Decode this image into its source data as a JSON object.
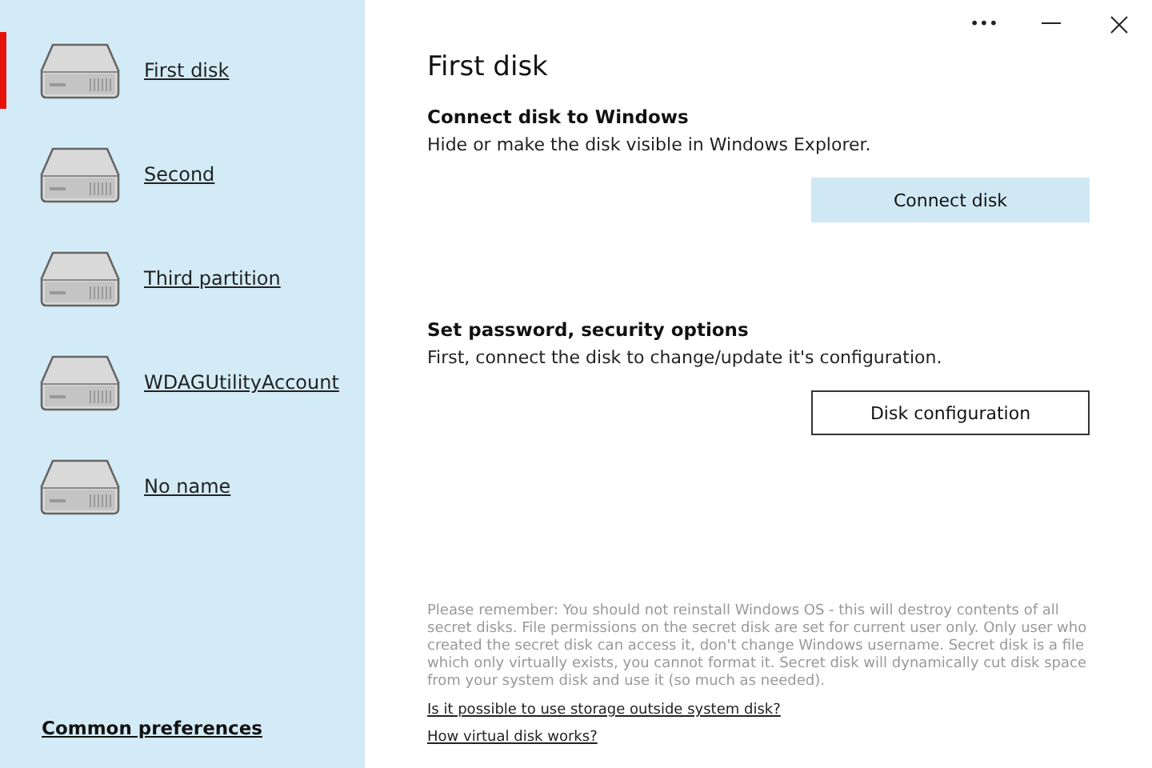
{
  "window_controls": [
    {
      "kind": "more",
      "label": "•••"
    },
    {
      "kind": "minimize"
    },
    {
      "kind": "close"
    }
  ],
  "sidebar": {
    "items": [
      {
        "label": "First disk",
        "selected": true
      },
      {
        "label": "Second",
        "selected": false
      },
      {
        "label": "Third partition",
        "selected": false
      },
      {
        "label": "WDAGUtilityAccount",
        "selected": false
      },
      {
        "label": "No name",
        "selected": false
      }
    ],
    "footer_link": "Common preferences"
  },
  "title": "First disk",
  "sections": [
    {
      "heading": "Connect disk to Windows",
      "description": "Hide or make the disk visible in Windows Explorer.",
      "button": "Connect disk",
      "kind": "primary"
    },
    {
      "heading": "Set password, security options",
      "description": "First, connect the disk to change/update it's configuration.",
      "button": "Disk configuration",
      "kind": "outline"
    }
  ],
  "notice": "Please remember: You should not reinstall Windows OS - this will destroy contents of all secret disks. File permissions on the secret disk are set for current user only. Only user who created the secret disk can access it, don't change Windows username. Secret disk is a file which only virtually exists, you cannot format it. Secret disk will dynamically cut disk space from your system disk and use it (so much as needed).",
  "links": [
    "Is it possible to use storage outside system disk?",
    "How virtual disk works?"
  ]
}
